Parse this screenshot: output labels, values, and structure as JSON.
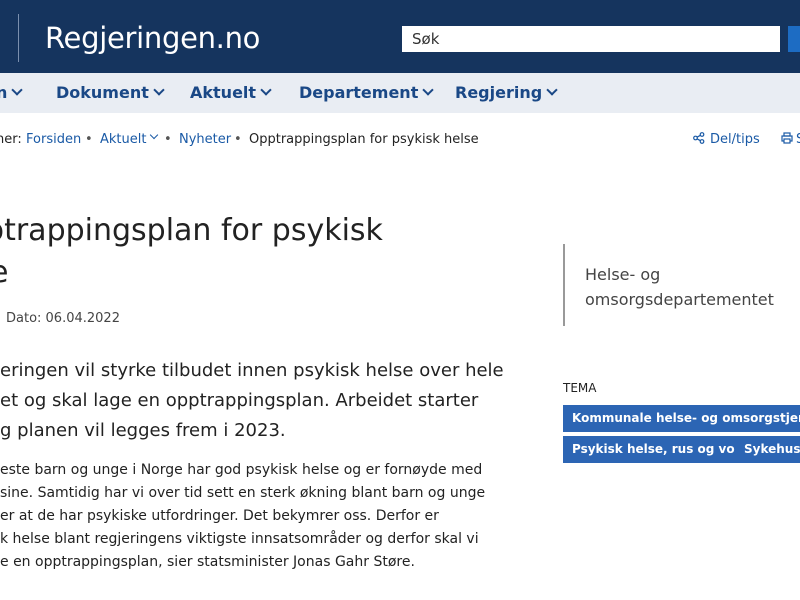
{
  "header": {
    "site_title": "Regjeringen.no",
    "search_placeholder": "Søk"
  },
  "nav": {
    "items": [
      {
        "label": "n"
      },
      {
        "label": "Dokument"
      },
      {
        "label": "Aktuelt"
      },
      {
        "label": "Departement"
      },
      {
        "label": "Regjering"
      }
    ]
  },
  "breadcrumb": {
    "prefix": "her:",
    "items": [
      "Forsiden",
      "Aktuelt",
      "Nyheter"
    ],
    "current": "Opptrappingsplan for psykisk helse"
  },
  "tools": {
    "share": "Del/tips",
    "print": "S"
  },
  "article": {
    "title_line1": "pptrappingsplan for psykisk",
    "title_line2": "lse",
    "date_label": "Dato: 06.04.2022",
    "lead_lines": [
      "eringen vil styrke tilbudet innen psykisk helse over hele",
      "et og skal lage en opptrappingsplan. Arbeidet starter",
      "g planen vil legges frem i 2023."
    ],
    "body_lines": [
      "este barn og unge i Norge har god psykisk helse og er fornøyde med",
      "sine. Samtidig har vi over tid sett en sterk økning blant barn og unge",
      "er at de har psykiske utfordringer. Det bekymrer oss. Derfor er",
      "k helse blant regjeringens viktigste innsatsområder og derfor skal vi",
      "e en opptrappingsplan, sier statsminister Jonas Gahr Støre."
    ]
  },
  "sidebar": {
    "department": "Helse- og omsorgsdepartementet",
    "tema_label": "TEMA",
    "tags": [
      "Kommunale helse- og omsorgstjenester",
      "Psykisk helse, rus og vold",
      "Sykehus"
    ]
  },
  "colors": {
    "header_bg": "#15345e",
    "nav_bg": "#e9edf3",
    "link": "#1a5aa6",
    "tag_bg": "#2c65b4"
  }
}
